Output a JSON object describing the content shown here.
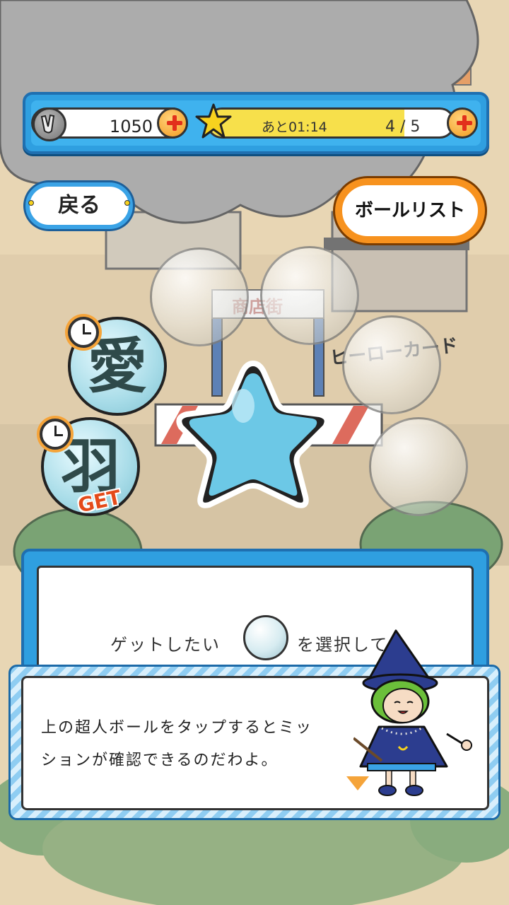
{
  "header": {
    "coins": "1050",
    "timer": "あと01:14",
    "star_count": "4 / 5",
    "star_progress": 0.8,
    "coin_plus_icon": "plus-icon",
    "star_plus_icon": "plus-icon"
  },
  "nav": {
    "back_label": "戻る",
    "ball_list_label": "ボールリスト"
  },
  "balls": [
    {
      "kanji": "愛",
      "timer": true,
      "get": false
    },
    {
      "kanji": "羽",
      "timer": true,
      "get": true,
      "badge": "GET"
    }
  ],
  "scenery": {
    "shop_sign": "商店街",
    "card_sign": "ヒーローカード"
  },
  "info": {
    "prefix": "ゲットしたい",
    "suffix": "を選択して"
  },
  "message": {
    "line1": "上の超人ボールをタップするとミッ",
    "line2": "ションが確認できるのだわよ。"
  },
  "colors": {
    "panel_blue": "#2f9fe0",
    "button_orange": "#f7921e",
    "star_blue": "#6cc8e6"
  }
}
